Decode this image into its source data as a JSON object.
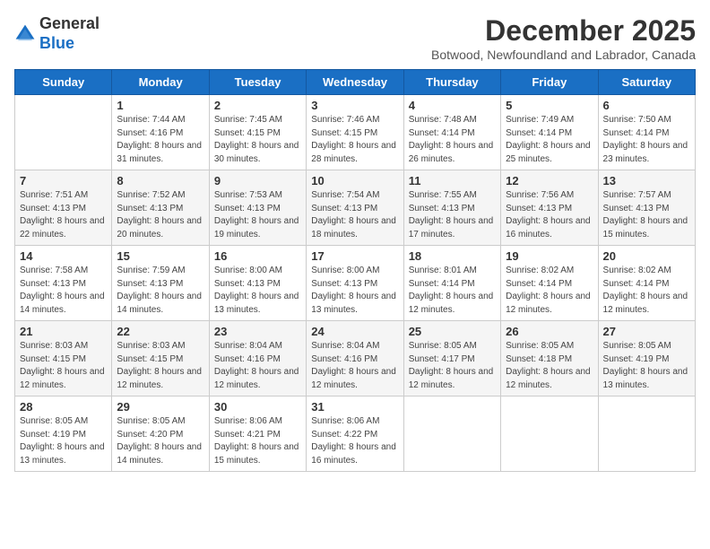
{
  "header": {
    "logo_general": "General",
    "logo_blue": "Blue",
    "month_title": "December 2025",
    "subtitle": "Botwood, Newfoundland and Labrador, Canada"
  },
  "days_of_week": [
    "Sunday",
    "Monday",
    "Tuesday",
    "Wednesday",
    "Thursday",
    "Friday",
    "Saturday"
  ],
  "weeks": [
    [
      {
        "day": "",
        "sunrise": "",
        "sunset": "",
        "daylight": ""
      },
      {
        "day": "1",
        "sunrise": "Sunrise: 7:44 AM",
        "sunset": "Sunset: 4:16 PM",
        "daylight": "Daylight: 8 hours and 31 minutes."
      },
      {
        "day": "2",
        "sunrise": "Sunrise: 7:45 AM",
        "sunset": "Sunset: 4:15 PM",
        "daylight": "Daylight: 8 hours and 30 minutes."
      },
      {
        "day": "3",
        "sunrise": "Sunrise: 7:46 AM",
        "sunset": "Sunset: 4:15 PM",
        "daylight": "Daylight: 8 hours and 28 minutes."
      },
      {
        "day": "4",
        "sunrise": "Sunrise: 7:48 AM",
        "sunset": "Sunset: 4:14 PM",
        "daylight": "Daylight: 8 hours and 26 minutes."
      },
      {
        "day": "5",
        "sunrise": "Sunrise: 7:49 AM",
        "sunset": "Sunset: 4:14 PM",
        "daylight": "Daylight: 8 hours and 25 minutes."
      },
      {
        "day": "6",
        "sunrise": "Sunrise: 7:50 AM",
        "sunset": "Sunset: 4:14 PM",
        "daylight": "Daylight: 8 hours and 23 minutes."
      }
    ],
    [
      {
        "day": "7",
        "sunrise": "Sunrise: 7:51 AM",
        "sunset": "Sunset: 4:13 PM",
        "daylight": "Daylight: 8 hours and 22 minutes."
      },
      {
        "day": "8",
        "sunrise": "Sunrise: 7:52 AM",
        "sunset": "Sunset: 4:13 PM",
        "daylight": "Daylight: 8 hours and 20 minutes."
      },
      {
        "day": "9",
        "sunrise": "Sunrise: 7:53 AM",
        "sunset": "Sunset: 4:13 PM",
        "daylight": "Daylight: 8 hours and 19 minutes."
      },
      {
        "day": "10",
        "sunrise": "Sunrise: 7:54 AM",
        "sunset": "Sunset: 4:13 PM",
        "daylight": "Daylight: 8 hours and 18 minutes."
      },
      {
        "day": "11",
        "sunrise": "Sunrise: 7:55 AM",
        "sunset": "Sunset: 4:13 PM",
        "daylight": "Daylight: 8 hours and 17 minutes."
      },
      {
        "day": "12",
        "sunrise": "Sunrise: 7:56 AM",
        "sunset": "Sunset: 4:13 PM",
        "daylight": "Daylight: 8 hours and 16 minutes."
      },
      {
        "day": "13",
        "sunrise": "Sunrise: 7:57 AM",
        "sunset": "Sunset: 4:13 PM",
        "daylight": "Daylight: 8 hours and 15 minutes."
      }
    ],
    [
      {
        "day": "14",
        "sunrise": "Sunrise: 7:58 AM",
        "sunset": "Sunset: 4:13 PM",
        "daylight": "Daylight: 8 hours and 14 minutes."
      },
      {
        "day": "15",
        "sunrise": "Sunrise: 7:59 AM",
        "sunset": "Sunset: 4:13 PM",
        "daylight": "Daylight: 8 hours and 14 minutes."
      },
      {
        "day": "16",
        "sunrise": "Sunrise: 8:00 AM",
        "sunset": "Sunset: 4:13 PM",
        "daylight": "Daylight: 8 hours and 13 minutes."
      },
      {
        "day": "17",
        "sunrise": "Sunrise: 8:00 AM",
        "sunset": "Sunset: 4:13 PM",
        "daylight": "Daylight: 8 hours and 13 minutes."
      },
      {
        "day": "18",
        "sunrise": "Sunrise: 8:01 AM",
        "sunset": "Sunset: 4:14 PM",
        "daylight": "Daylight: 8 hours and 12 minutes."
      },
      {
        "day": "19",
        "sunrise": "Sunrise: 8:02 AM",
        "sunset": "Sunset: 4:14 PM",
        "daylight": "Daylight: 8 hours and 12 minutes."
      },
      {
        "day": "20",
        "sunrise": "Sunrise: 8:02 AM",
        "sunset": "Sunset: 4:14 PM",
        "daylight": "Daylight: 8 hours and 12 minutes."
      }
    ],
    [
      {
        "day": "21",
        "sunrise": "Sunrise: 8:03 AM",
        "sunset": "Sunset: 4:15 PM",
        "daylight": "Daylight: 8 hours and 12 minutes."
      },
      {
        "day": "22",
        "sunrise": "Sunrise: 8:03 AM",
        "sunset": "Sunset: 4:15 PM",
        "daylight": "Daylight: 8 hours and 12 minutes."
      },
      {
        "day": "23",
        "sunrise": "Sunrise: 8:04 AM",
        "sunset": "Sunset: 4:16 PM",
        "daylight": "Daylight: 8 hours and 12 minutes."
      },
      {
        "day": "24",
        "sunrise": "Sunrise: 8:04 AM",
        "sunset": "Sunset: 4:16 PM",
        "daylight": "Daylight: 8 hours and 12 minutes."
      },
      {
        "day": "25",
        "sunrise": "Sunrise: 8:05 AM",
        "sunset": "Sunset: 4:17 PM",
        "daylight": "Daylight: 8 hours and 12 minutes."
      },
      {
        "day": "26",
        "sunrise": "Sunrise: 8:05 AM",
        "sunset": "Sunset: 4:18 PM",
        "daylight": "Daylight: 8 hours and 12 minutes."
      },
      {
        "day": "27",
        "sunrise": "Sunrise: 8:05 AM",
        "sunset": "Sunset: 4:19 PM",
        "daylight": "Daylight: 8 hours and 13 minutes."
      }
    ],
    [
      {
        "day": "28",
        "sunrise": "Sunrise: 8:05 AM",
        "sunset": "Sunset: 4:19 PM",
        "daylight": "Daylight: 8 hours and 13 minutes."
      },
      {
        "day": "29",
        "sunrise": "Sunrise: 8:05 AM",
        "sunset": "Sunset: 4:20 PM",
        "daylight": "Daylight: 8 hours and 14 minutes."
      },
      {
        "day": "30",
        "sunrise": "Sunrise: 8:06 AM",
        "sunset": "Sunset: 4:21 PM",
        "daylight": "Daylight: 8 hours and 15 minutes."
      },
      {
        "day": "31",
        "sunrise": "Sunrise: 8:06 AM",
        "sunset": "Sunset: 4:22 PM",
        "daylight": "Daylight: 8 hours and 16 minutes."
      },
      {
        "day": "",
        "sunrise": "",
        "sunset": "",
        "daylight": ""
      },
      {
        "day": "",
        "sunrise": "",
        "sunset": "",
        "daylight": ""
      },
      {
        "day": "",
        "sunrise": "",
        "sunset": "",
        "daylight": ""
      }
    ]
  ]
}
